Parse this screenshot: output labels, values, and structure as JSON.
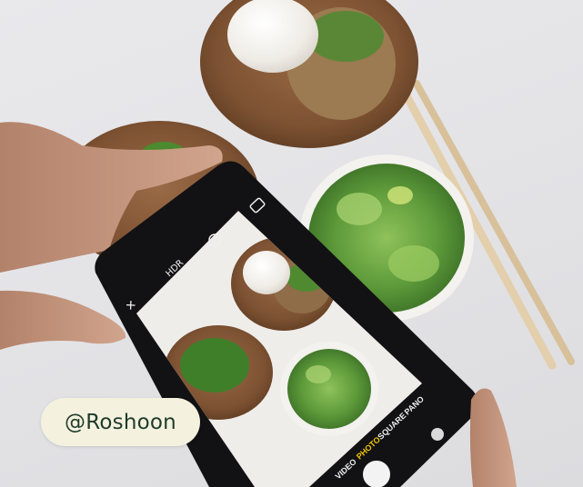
{
  "badge": {
    "handle": "@Roshoon"
  },
  "camera_modes": [
    "VIDEO",
    "PHOTO",
    "SQUARE",
    "PANO"
  ],
  "active_mode": "PHOTO",
  "colors": {
    "badge_bg": "#f4f2df",
    "badge_text": "#1f3b2a",
    "active_mode": "#f2c500"
  },
  "icons": [
    "flash-icon",
    "hdr-icon",
    "live-photo-icon",
    "timer-icon",
    "camera-switch-icon",
    "shutter-button-icon"
  ]
}
